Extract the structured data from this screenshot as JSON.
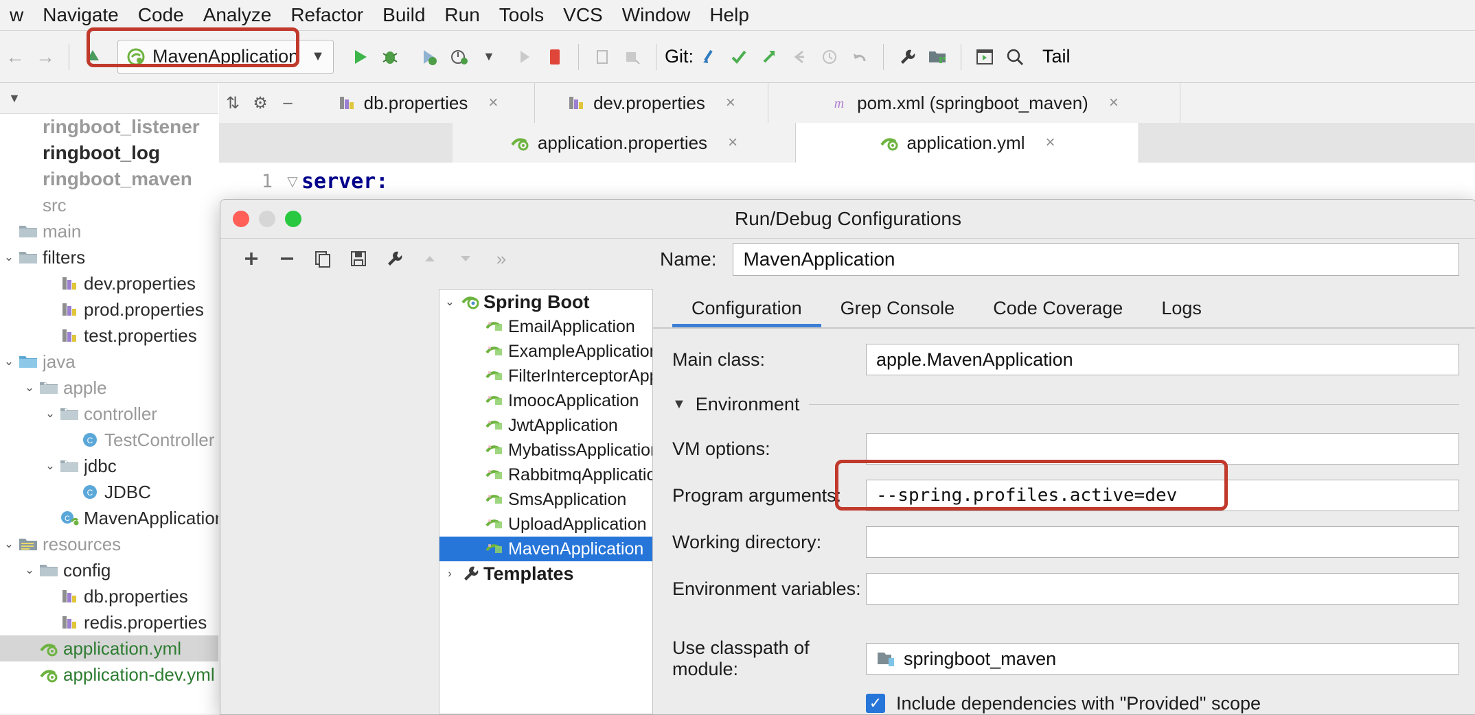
{
  "menubar": {
    "items": [
      "w",
      "Navigate",
      "Code",
      "Analyze",
      "Refactor",
      "Build",
      "Run",
      "Tools",
      "VCS",
      "Window",
      "Help"
    ]
  },
  "toolbar": {
    "back_icon": "back-arrow-icon",
    "forward_icon": "forward-arrow-icon",
    "run_config_name": "MavenApplication",
    "run_config_icon": "spring-boot-icon",
    "dropdown_icon": "chevron-down-icon",
    "run_icon": "run-icon",
    "debug_icon": "debug-icon",
    "run_with_coverage_icon": "run-coverage-icon",
    "profile_icon": "profile-icon",
    "profile_dropdown_icon": "chevron-down-icon",
    "rerun_icon": "rerun-icon",
    "stop_icon": "stop-icon",
    "build_icon": "build-icon",
    "build_module_icon": "build-module-icon",
    "git_label": "Git:",
    "update_project_icon": "update-project-icon",
    "commit_icon": "commit-checkmark-icon",
    "push_icon": "push-arrow-icon",
    "revert_icon": "revert-icon",
    "history_icon": "history-clock-icon",
    "undo_icon": "undo-icon",
    "settings_icon": "wrench-settings-icon",
    "project_structure_icon": "project-structure-icon",
    "terminal_icon": "terminal-icon",
    "search_icon": "search-icon",
    "tail_label": "Tail"
  },
  "project_tree": {
    "header_icons": [
      "chevron-down-icon"
    ],
    "nodes": [
      {
        "label": "ringboot_listener",
        "indent": 0,
        "twisty": "",
        "icon": "none",
        "bold": true,
        "muted": true,
        "selected": false
      },
      {
        "label": "ringboot_log",
        "indent": 0,
        "twisty": "",
        "icon": "none",
        "bold": true,
        "muted": false,
        "selected": false
      },
      {
        "label": "ringboot_maven",
        "indent": 0,
        "twisty": "",
        "icon": "none",
        "bold": true,
        "muted": true,
        "selected": false
      },
      {
        "label": "src",
        "indent": 0,
        "twisty": "",
        "icon": "none",
        "bold": false,
        "muted": true,
        "selected": false
      },
      {
        "label": "main",
        "indent": 0,
        "twisty": "",
        "icon": "folder",
        "bold": false,
        "muted": true,
        "selected": false
      },
      {
        "label": "filters",
        "indent": 0,
        "twisty": "down",
        "icon": "folder",
        "bold": false,
        "muted": false,
        "selected": false
      },
      {
        "label": "dev.properties",
        "indent": 2,
        "twisty": "",
        "icon": "properties",
        "bold": false,
        "muted": false,
        "selected": false
      },
      {
        "label": "prod.properties",
        "indent": 2,
        "twisty": "",
        "icon": "properties",
        "bold": false,
        "muted": false,
        "selected": false
      },
      {
        "label": "test.properties",
        "indent": 2,
        "twisty": "",
        "icon": "properties",
        "bold": false,
        "muted": false,
        "selected": false
      },
      {
        "label": "java",
        "indent": 0,
        "twisty": "down",
        "icon": "folder-src",
        "bold": false,
        "muted": true,
        "selected": false
      },
      {
        "label": "apple",
        "indent": 1,
        "twisty": "down",
        "icon": "package",
        "bold": false,
        "muted": true,
        "selected": false
      },
      {
        "label": "controller",
        "indent": 2,
        "twisty": "down",
        "icon": "package",
        "bold": false,
        "muted": true,
        "selected": false
      },
      {
        "label": "TestController",
        "indent": 3,
        "twisty": "",
        "icon": "class",
        "bold": false,
        "muted": true,
        "selected": false
      },
      {
        "label": "jdbc",
        "indent": 2,
        "twisty": "down",
        "icon": "package",
        "bold": false,
        "muted": false,
        "selected": false
      },
      {
        "label": "JDBC",
        "indent": 3,
        "twisty": "",
        "icon": "class",
        "bold": false,
        "muted": false,
        "selected": false
      },
      {
        "label": "MavenApplication",
        "indent": 2,
        "twisty": "",
        "icon": "spring-class",
        "bold": false,
        "muted": false,
        "selected": false
      },
      {
        "label": "resources",
        "indent": 0,
        "twisty": "down",
        "icon": "resources",
        "bold": false,
        "muted": true,
        "selected": false
      },
      {
        "label": "config",
        "indent": 1,
        "twisty": "down",
        "icon": "folder",
        "bold": false,
        "muted": false,
        "selected": false
      },
      {
        "label": "db.properties",
        "indent": 2,
        "twisty": "",
        "icon": "properties",
        "bold": false,
        "muted": false,
        "selected": false
      },
      {
        "label": "redis.properties",
        "indent": 2,
        "twisty": "",
        "icon": "properties",
        "bold": false,
        "muted": false,
        "selected": false
      },
      {
        "label": "application.yml",
        "indent": 1,
        "twisty": "",
        "icon": "yml",
        "bold": false,
        "muted": false,
        "selected": true,
        "green": true
      },
      {
        "label": "application-dev.yml",
        "indent": 1,
        "twisty": "",
        "icon": "yml",
        "bold": false,
        "muted": false,
        "selected": false,
        "green": true
      }
    ]
  },
  "editor": {
    "gutter_icons": [
      "collapse-all-icon",
      "gear-icon",
      "hide-icon"
    ],
    "tabs_row1": [
      {
        "label": "db.properties",
        "icon": "properties-icon",
        "active": false,
        "close": "×"
      },
      {
        "label": "dev.properties",
        "icon": "properties-icon",
        "active": false,
        "close": "×"
      },
      {
        "label": "pom.xml (springboot_maven)",
        "icon": "maven-icon",
        "active": false,
        "close": "×"
      }
    ],
    "tabs_row2": [
      {
        "label": "application.properties",
        "icon": "spring-icon",
        "active": false,
        "close": "×"
      },
      {
        "label": "application.yml",
        "icon": "spring-icon",
        "active": true,
        "close": "×"
      }
    ],
    "line_number": "1",
    "fold_marker": "▽",
    "code_text": "server:"
  },
  "dialog": {
    "title": "Run/Debug Configurations",
    "traffic_lights": [
      "close-button",
      "minimize-button",
      "maximize-button"
    ],
    "toolbar_icons": [
      {
        "name": "add-icon",
        "glyph": "+",
        "dim": false
      },
      {
        "name": "remove-icon",
        "glyph": "−",
        "dim": false
      },
      {
        "name": "copy-configuration-icon",
        "glyph": "⧉",
        "dim": false
      },
      {
        "name": "save-configuration-icon",
        "glyph": "Ὃe",
        "dim": false
      },
      {
        "name": "edit-templates-icon",
        "glyph": "ὒ7",
        "dim": false
      },
      {
        "name": "move-up-icon",
        "glyph": "▲",
        "dim": true
      },
      {
        "name": "move-down-icon",
        "glyph": "▼",
        "dim": true
      },
      {
        "name": "more-options-icon",
        "glyph": "»",
        "dim": true
      }
    ],
    "name_label": "Name:",
    "name_value": "MavenApplication",
    "config_tree": [
      {
        "label": "Spring Boot",
        "indent": 0,
        "twisty": "down",
        "icon": "spring-boot-icon",
        "bold": true,
        "selected": false
      },
      {
        "label": "EmailApplication",
        "indent": 1,
        "twisty": "",
        "icon": "spring-run-icon",
        "bold": false,
        "selected": false
      },
      {
        "label": "ExampleApplication",
        "indent": 1,
        "twisty": "",
        "icon": "spring-run-icon",
        "bold": false,
        "selected": false
      },
      {
        "label": "FilterInterceptorApplic",
        "indent": 1,
        "twisty": "",
        "icon": "spring-run-icon",
        "bold": false,
        "selected": false
      },
      {
        "label": "ImoocApplication",
        "indent": 1,
        "twisty": "",
        "icon": "spring-run-icon",
        "bold": false,
        "selected": false
      },
      {
        "label": "JwtApplication",
        "indent": 1,
        "twisty": "",
        "icon": "spring-run-icon",
        "bold": false,
        "selected": false
      },
      {
        "label": "MybatissApplication",
        "indent": 1,
        "twisty": "",
        "icon": "spring-run-icon",
        "bold": false,
        "selected": false
      },
      {
        "label": "RabbitmqApplication",
        "indent": 1,
        "twisty": "",
        "icon": "spring-run-icon",
        "bold": false,
        "selected": false
      },
      {
        "label": "SmsApplication",
        "indent": 1,
        "twisty": "",
        "icon": "spring-run-icon",
        "bold": false,
        "selected": false
      },
      {
        "label": "UploadApplication",
        "indent": 1,
        "twisty": "",
        "icon": "spring-run-icon",
        "bold": false,
        "selected": false
      },
      {
        "label": "MavenApplication",
        "indent": 1,
        "twisty": "",
        "icon": "spring-run-icon",
        "bold": false,
        "selected": true
      },
      {
        "label": "Templates",
        "indent": 0,
        "twisty": "right",
        "icon": "wrench-icon",
        "bold": true,
        "selected": false
      }
    ],
    "tabs": [
      {
        "label": "Configuration",
        "active": true
      },
      {
        "label": "Grep Console",
        "active": false
      },
      {
        "label": "Code Coverage",
        "active": false
      },
      {
        "label": "Logs",
        "active": false
      }
    ],
    "fields": {
      "main_class_label": "Main class:",
      "main_class_value": "apple.MavenApplication",
      "environment_label": "Environment",
      "environment_twisty": "▼",
      "vm_options_label": "VM options:",
      "vm_options_value": "",
      "program_arguments_label": "Program arguments:",
      "program_arguments_value": "--spring.profiles.active=dev",
      "working_directory_label": "Working directory:",
      "working_directory_value": "",
      "environment_variables_label": "Environment variables:",
      "environment_variables_value": "",
      "classpath_module_label": "Use classpath of module:",
      "classpath_module_value": "springboot_maven",
      "classpath_module_icon": "module-icon",
      "include_provided_label": "Include dependencies with \"Provided\" scope",
      "include_provided_checked": true,
      "checkmark": "✓"
    }
  },
  "annotations": {
    "accent_color": "#c0392b",
    "boxes": [
      {
        "name": "run-config-highlight"
      },
      {
        "name": "program-arguments-highlight"
      }
    ]
  }
}
